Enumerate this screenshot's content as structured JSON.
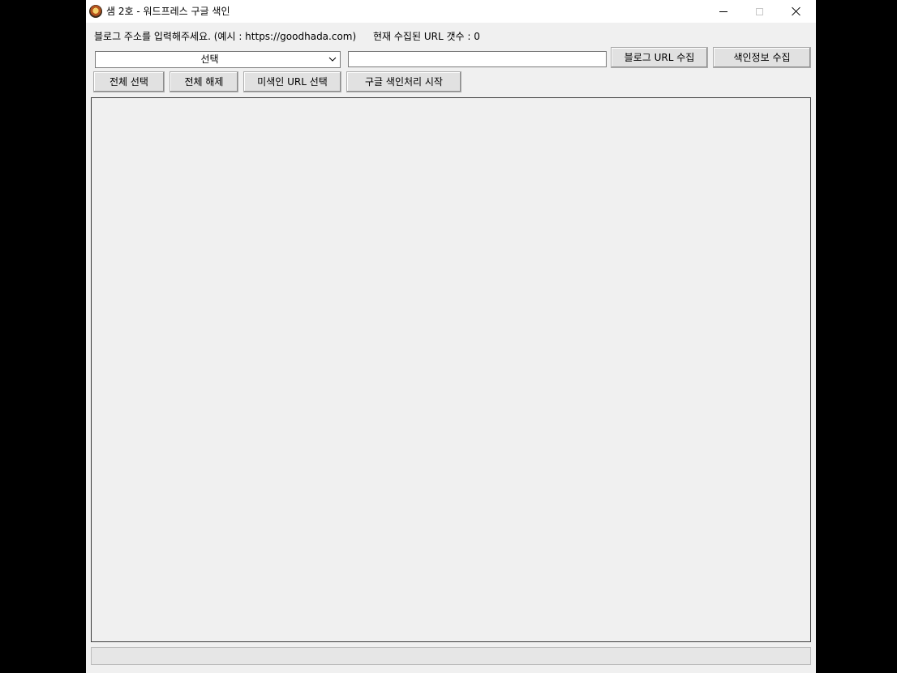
{
  "window": {
    "title": "샘 2호 - 워드프레스 구글 색인",
    "icon": "app-logo-icon"
  },
  "labels": {
    "instruction": "블로그 주소를 입력해주세요. (예시 : https://goodhada.com)",
    "url_count": "현재 수집된 URL 갯수 : 0"
  },
  "combo": {
    "selected": "선택"
  },
  "url_input": {
    "value": ""
  },
  "buttons": {
    "collect_blog_url": "블로그 URL 수집",
    "collect_index_info": "색인정보 수집",
    "select_all": "전체 선택",
    "deselect_all": "전체 해제",
    "select_unindexed": "미색인 URL 선택",
    "start_google_index": "구글 색인처리 시작"
  },
  "url_list": {
    "items": []
  },
  "progress": {
    "value": 0
  }
}
